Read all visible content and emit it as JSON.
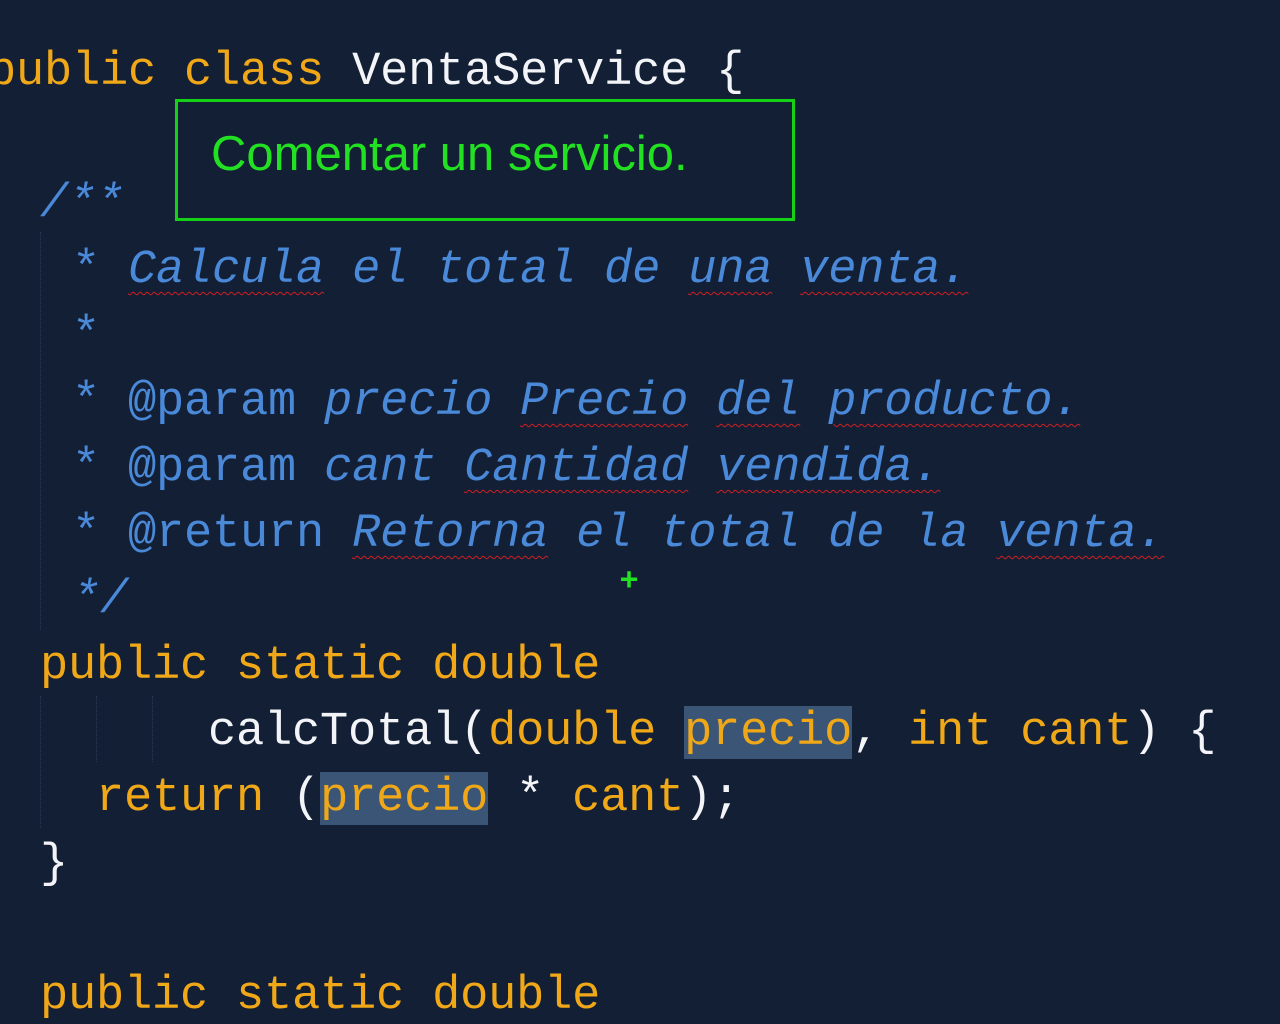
{
  "tooltip": {
    "text": "Comentar un servicio."
  },
  "code": {
    "class_decl": {
      "keyword_public": "public",
      "keyword_class": "class",
      "class_name": "VentaService",
      "open_brace": "{"
    },
    "javadoc": {
      "open": "/**",
      "line1_star": "*",
      "line1_words": [
        "Calcula",
        "el",
        "total",
        "de",
        "una",
        "venta."
      ],
      "line2_star": "*",
      "line3_star": "*",
      "line3_tag": "@param",
      "line3_name": "precio",
      "line3_words": [
        "Precio",
        "del",
        "producto."
      ],
      "line4_star": "*",
      "line4_tag": "@param",
      "line4_name": "cant",
      "line4_words": [
        "Cantidad",
        "vendida."
      ],
      "line5_star": "*",
      "line5_tag": "@return",
      "line5_words": [
        "Retorna",
        "el",
        "total",
        "de",
        "la",
        "venta."
      ],
      "close": "*/"
    },
    "method1": {
      "modifiers": "public static double",
      "name": "calcTotal",
      "open_paren": "(",
      "param1_type": "double",
      "param1_name": "precio",
      "comma": ",",
      "param2_type": "int",
      "param2_name": "cant",
      "close_paren": ")",
      "open_brace": "{",
      "return_kw": "return",
      "expr_open": "(",
      "expr_var1": "precio",
      "expr_op": "*",
      "expr_var2": "cant",
      "expr_close": ");",
      "close_brace": "}"
    },
    "method2": {
      "modifiers": "public static double"
    }
  },
  "colors": {
    "background": "#131f35",
    "keyword": "#f0a818",
    "comment": "#4a88d8",
    "plain": "#f2f4f8",
    "highlight": "#3a5575",
    "tooltip_border": "#16d016",
    "tooltip_text": "#22e022",
    "spellcheck": "#d02020"
  }
}
